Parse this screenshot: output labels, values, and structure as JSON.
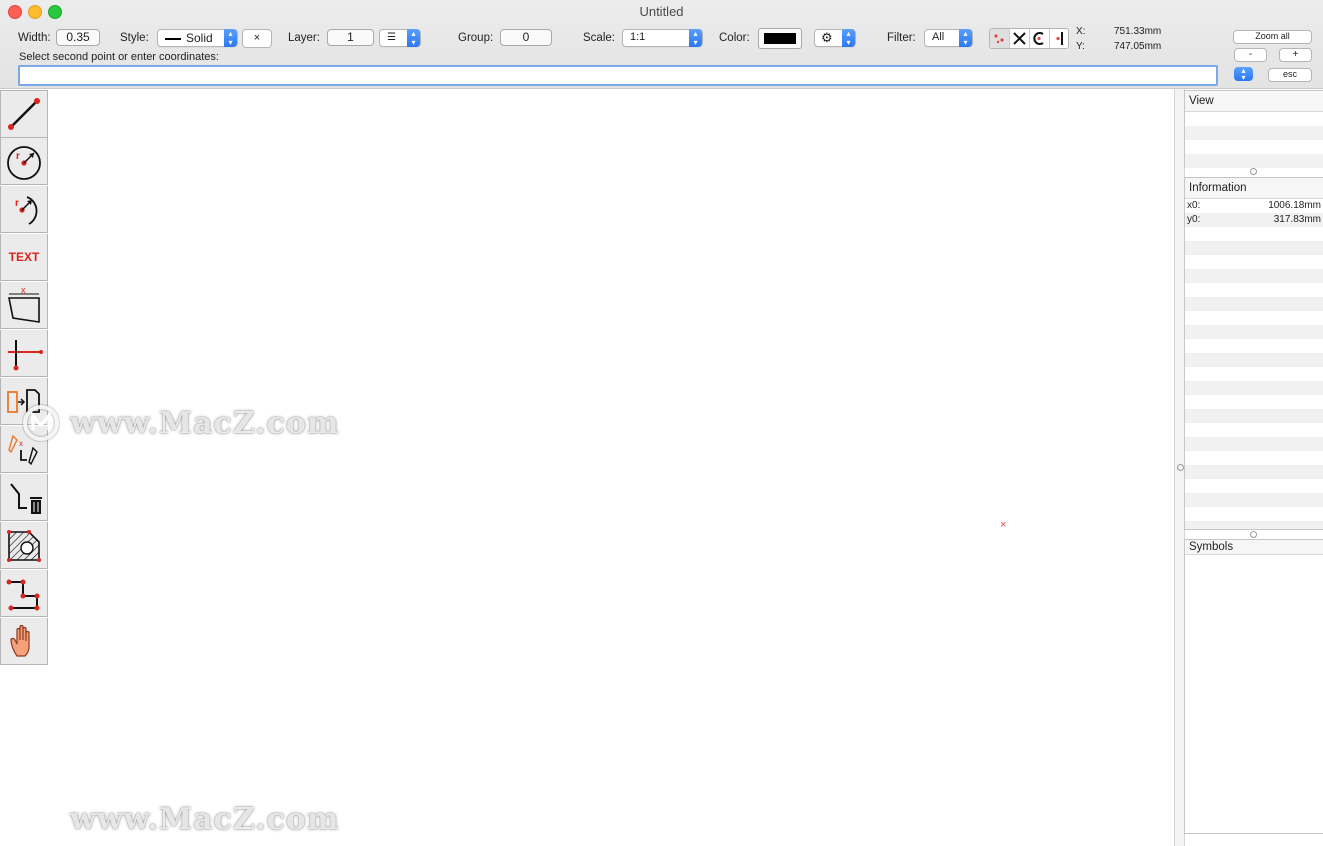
{
  "window": {
    "title": "Untitled"
  },
  "toolbar": {
    "width_label": "Width:",
    "width_value": "0.35",
    "style_label": "Style:",
    "style_value": "Solid",
    "style_clear": "×",
    "layer_label": "Layer:",
    "layer_value": "1",
    "group_label": "Group:",
    "group_value": "0",
    "scale_label": "Scale:",
    "scale_value": "1:1",
    "color_label": "Color:",
    "color_value": "#000000",
    "filter_label": "Filter:",
    "filter_value": "All",
    "coord_x_label": "X:",
    "coord_x_value": "751.33mm",
    "coord_y_label": "Y:",
    "coord_y_value": "747.05mm",
    "zoom_all_label": "Zoom all",
    "zoom_out_label": "-",
    "zoom_in_label": "+",
    "esc_label": "esc"
  },
  "command": {
    "prompt": "Select second point or enter coordinates:",
    "input_value": ""
  },
  "tools": [
    {
      "name": "line-tool-icon"
    },
    {
      "name": "circle-tool-icon"
    },
    {
      "name": "arc-tool-icon"
    },
    {
      "name": "text-tool-icon",
      "text": "TEXT"
    },
    {
      "name": "dimension-tool-icon",
      "text": "x"
    },
    {
      "name": "trim-tool-icon"
    },
    {
      "name": "copy-tool-icon"
    },
    {
      "name": "edit-tool-icon",
      "text": "x"
    },
    {
      "name": "delete-tool-icon"
    },
    {
      "name": "hatch-tool-icon"
    },
    {
      "name": "polyline-tool-icon"
    },
    {
      "name": "pan-hand-icon"
    }
  ],
  "panels": {
    "view": {
      "title": "View"
    },
    "information": {
      "title": "Information",
      "rows": [
        {
          "label": "x0:",
          "value": "1006.18mm"
        },
        {
          "label": "y0:",
          "value": "317.83mm"
        }
      ]
    },
    "symbols": {
      "title": "Symbols"
    }
  },
  "watermark": {
    "text": "www.MacZ.com"
  },
  "colors": {
    "accent": "#2b77f0",
    "marker": "#e8463c",
    "tool_red": "#d9251d"
  }
}
